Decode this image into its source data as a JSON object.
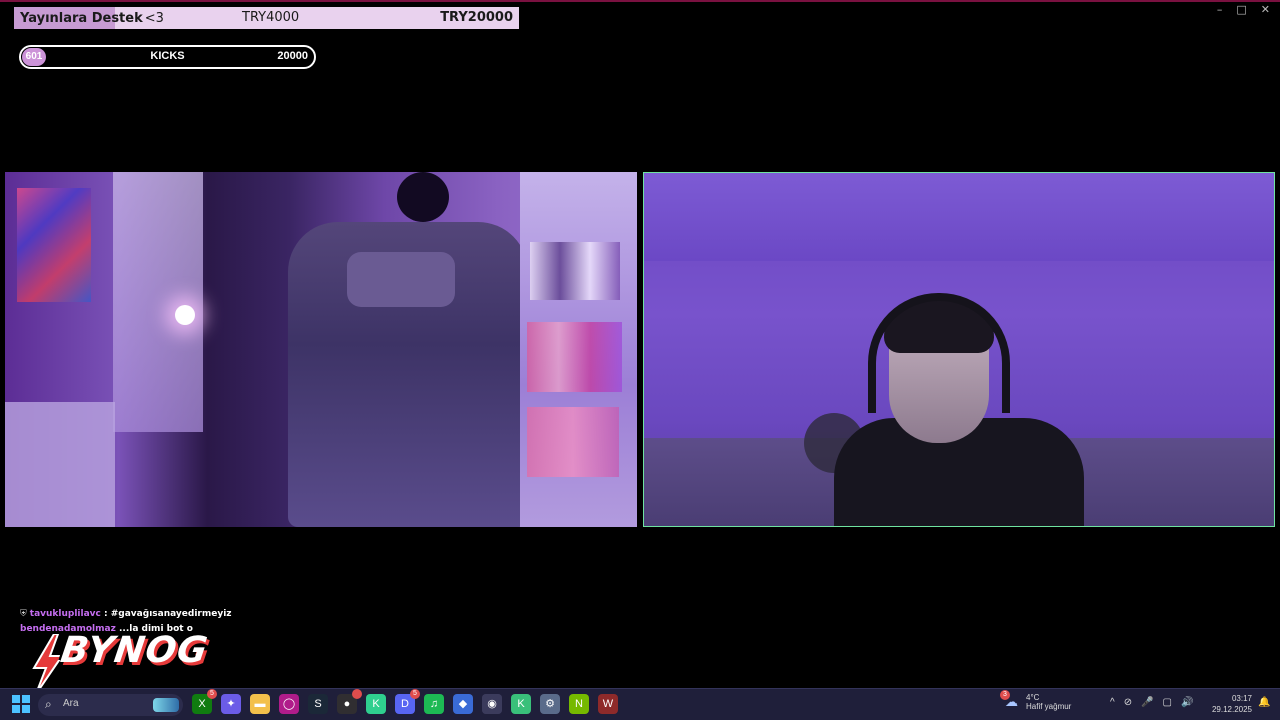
{
  "window": {
    "controls": [
      "–",
      "□",
      "✕"
    ]
  },
  "donation_goal": {
    "label": "Yayınlara Destek",
    "heart": "<3",
    "current": "TRY4000",
    "goal": "TRY20000",
    "progress_fraction": 0.2
  },
  "kicks_goal": {
    "count": "601",
    "label": "KICKS",
    "target": "20000"
  },
  "chat": [
    {
      "user": "tavukluplilavc",
      "message": "#gavağısanayedirmeyiz",
      "icon": "shield-icon"
    },
    {
      "user": "bendenadamolmaz",
      "message": "...la dimi bot o"
    }
  ],
  "logo": {
    "text": "BYNOG"
  },
  "taskbar": {
    "search_placeholder": "Ara",
    "apps": [
      {
        "name": "xbox-icon",
        "glyph": "X",
        "color": "#107c10",
        "badge": "5"
      },
      {
        "name": "copilot-icon",
        "glyph": "✦",
        "color": "#6b5ce7"
      },
      {
        "name": "folder-icon",
        "glyph": "▬",
        "color": "#f3c04b"
      },
      {
        "name": "circle-app-icon",
        "glyph": "◯",
        "color": "#b01c8a"
      },
      {
        "name": "steam-icon",
        "glyph": "S",
        "color": "#1b2838"
      },
      {
        "name": "obs-icon",
        "glyph": "●",
        "color": "#302e31",
        "badge": ""
      },
      {
        "name": "kick-app-icon",
        "glyph": "K",
        "color": "#2fcf8f"
      },
      {
        "name": "discord-icon",
        "glyph": "D",
        "color": "#5865f2",
        "badge": "5"
      },
      {
        "name": "spotify-icon",
        "glyph": "♫",
        "color": "#1db954"
      },
      {
        "name": "app-icon",
        "glyph": "◆",
        "color": "#3a6bd6"
      },
      {
        "name": "chrome-icon",
        "glyph": "◉",
        "color": "#e44d3a",
        "active": true
      },
      {
        "name": "kick-studio-icon",
        "glyph": "K",
        "color": "#39c07a"
      },
      {
        "name": "settings-icon",
        "glyph": "⚙",
        "color": "#5a6b8a"
      },
      {
        "name": "nvidia-icon",
        "glyph": "N",
        "color": "#76b900"
      },
      {
        "name": "winrar-icon",
        "glyph": "W",
        "color": "#8e2a2a"
      }
    ],
    "weather": {
      "badge": "3",
      "temp": "4°C",
      "desc": "Hafif yağmur"
    },
    "tray": [
      "^",
      "⊘",
      "🎤",
      "▢",
      "🔊"
    ],
    "clock": {
      "time": "03:17",
      "date": "29.12.2025"
    },
    "notify": "🔔"
  }
}
